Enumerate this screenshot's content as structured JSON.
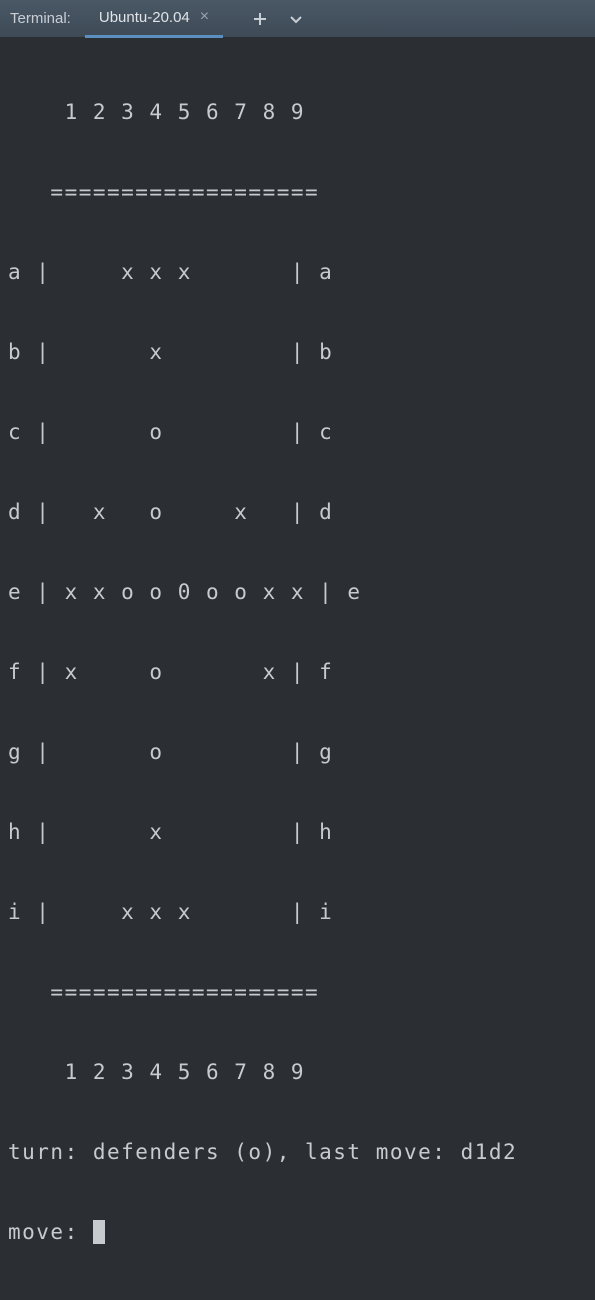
{
  "header": {
    "title_label": "Terminal:",
    "tab_label": "Ubuntu-20.04",
    "add_icon": "plus-icon",
    "more_icon": "chevron-down-icon"
  },
  "board": {
    "col_header": "    1 2 3 4 5 6 7 8 9",
    "divider": "   ===================",
    "rows": [
      "a |     x x x       | a",
      "b |       x         | b",
      "c |       o         | c",
      "d |   x   o     x   | d",
      "e | x x o o 0 o o x x | e",
      "f | x     o       x | f",
      "g |       o         | g",
      "h |       x         | h",
      "i |     x x x       | i"
    ]
  },
  "status_line": "turn: defenders (o), last move: d1d2",
  "prompt_label": "move: "
}
